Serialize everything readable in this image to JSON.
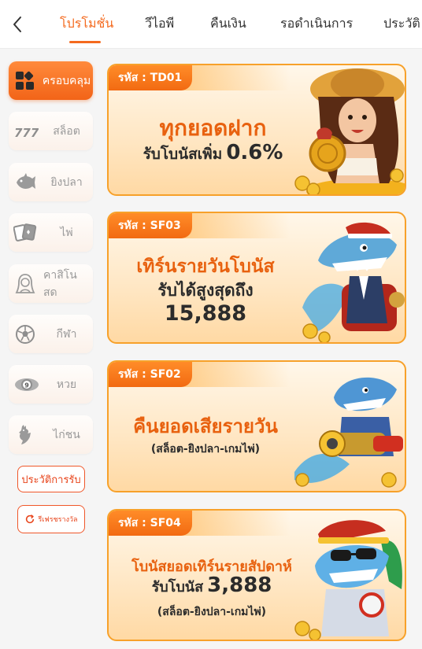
{
  "nav": {
    "back_icon": "chevron-left-icon",
    "tabs": [
      "โปรโมชั่น",
      "วีไอพี",
      "คืนเงิน",
      "รอดำเนินการ",
      "ประวัติ"
    ],
    "active_tab": 0,
    "accent": "#f46a1e"
  },
  "sidebar": {
    "items": [
      {
        "label": "ครอบคลุม",
        "icon": "grid-icon",
        "active": true
      },
      {
        "label": "สล็อต",
        "icon": "slot-777-icon",
        "active": false
      },
      {
        "label": "ยิงปลา",
        "icon": "fish-icon",
        "active": false
      },
      {
        "label": "ไพ่",
        "icon": "cards-icon",
        "active": false
      },
      {
        "label": "คาสิโนสด",
        "icon": "dealer-icon",
        "active": false
      },
      {
        "label": "กีฬา",
        "icon": "soccer-ball-icon",
        "active": false
      },
      {
        "label": "หวย",
        "icon": "lottery-ball-icon",
        "active": false
      },
      {
        "label": "ไก่ชน",
        "icon": "rooster-icon",
        "active": false
      }
    ],
    "history_button": "ประวัติการรับ",
    "refresh_button": "รีเฟรชรางวัล"
  },
  "promotions": [
    {
      "code": "รหัส : TD01",
      "line1": "ทุกยอดฝาก",
      "line2_prefix": "รับโบนัสเพิ่ม",
      "line2_value": "0.6%",
      "art": "treasure-girl-illustration"
    },
    {
      "code": "รหัส : SF03",
      "line1": "เทิร์นรายวันโบนัส",
      "line2": "รับได้สูงสุดถึง",
      "line3": "15,888",
      "art": "shark-captain-illustration"
    },
    {
      "code": "รหัส : SF02",
      "line1": "คืนยอดเสียรายวัน",
      "line2": "(สล็อต-ยิงปลา-เกมไพ่)",
      "art": "shark-cannon-illustration"
    },
    {
      "code": "รหัส : SF04",
      "line1": "โบนัสยอดเทิร์นรายสัปดาห์",
      "line2_prefix": "รับโบนัส",
      "line2_value": "3,888",
      "line3": "(สล็อต-ยิงปลา-เกมไพ่)",
      "art": "shark-sunglasses-illustration"
    }
  ]
}
